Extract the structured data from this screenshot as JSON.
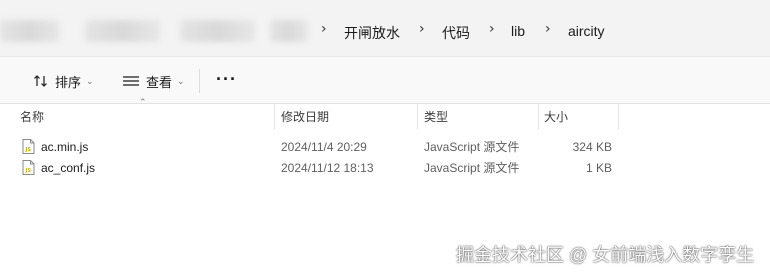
{
  "address_bar": {
    "path": [
      "开闸放水",
      "代码",
      "lib",
      "aircity"
    ]
  },
  "toolbar": {
    "sort_label": "排序",
    "view_label": "查看",
    "more_label": "···"
  },
  "columns": {
    "name": "名称",
    "date_modified": "修改日期",
    "type": "类型",
    "size": "大小"
  },
  "files": [
    {
      "name": "ac.min.js",
      "date_modified": "2024/11/4 20:29",
      "type": "JavaScript 源文件",
      "size": "324 KB"
    },
    {
      "name": "ac_conf.js",
      "date_modified": "2024/11/12 18:13",
      "type": "JavaScript 源文件",
      "size": "1 KB"
    }
  ],
  "watermark": "掘金技术社区 @ 女前端浅入数字孪生",
  "colors": {
    "address_bg": "#f3f3f3",
    "toolbar_bg": "#f9f9f9",
    "js_icon_accent": "#c7b100"
  },
  "icons": [
    "chevron-right-icon",
    "sort-icon",
    "view-icon",
    "more-icon",
    "js-file-icon"
  ]
}
